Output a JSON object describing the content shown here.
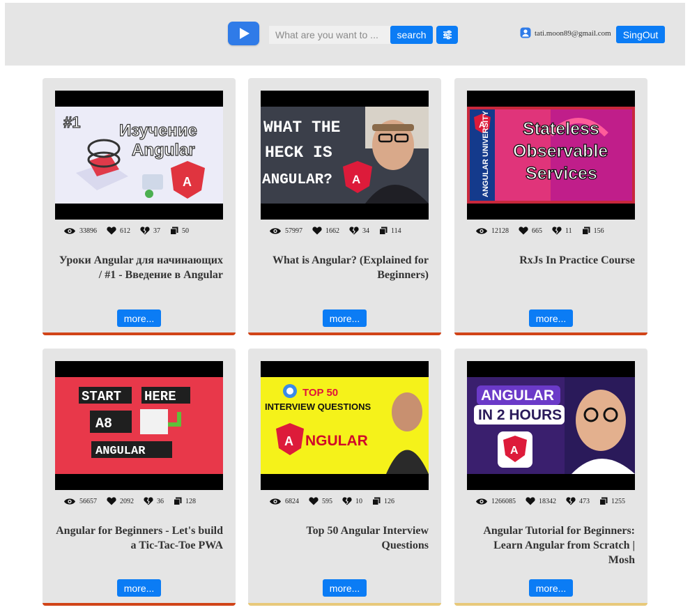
{
  "header": {
    "search_placeholder": "What are you want to ...",
    "search_label": "search",
    "user_email": "tati.moon89@gmail.com",
    "signout_label": "SingOut"
  },
  "colors": {
    "accent": "#0b7cf5",
    "card_bar_red": "#d14418",
    "card_bar_gold": "#e8c97a"
  },
  "cards": [
    {
      "views": "33896",
      "likes": "612",
      "dislikes": "37",
      "comments": "50",
      "title": "Уроки Angular для начинающих / #1 - Введение в Angular",
      "more_label": "more...",
      "thumb_text": [
        "#1",
        "Изучение",
        "Angular"
      ]
    },
    {
      "views": "57997",
      "likes": "1662",
      "dislikes": "34",
      "comments": "114",
      "title": "What is Angular? (Explained for Beginners)",
      "more_label": "more...",
      "thumb_text": [
        "WHAT THE",
        "HECK IS",
        "ANGULAR?"
      ]
    },
    {
      "views": "12128",
      "likes": "665",
      "dislikes": "11",
      "comments": "156",
      "title": "RxJs In Practice Course",
      "more_label": "more...",
      "thumb_text": [
        "Stateless",
        "Observable",
        "Services",
        "ANGULAR UNIVERSITY"
      ]
    },
    {
      "views": "56657",
      "likes": "2092",
      "dislikes": "36",
      "comments": "128",
      "title": "Angular for Beginners - Let's build a Tic-Tac-Toe PWA",
      "more_label": "more...",
      "thumb_text": [
        "START",
        "HERE",
        "ANGULAR"
      ]
    },
    {
      "views": "6824",
      "likes": "595",
      "dislikes": "10",
      "comments": "126",
      "title": "Top 50 Angular Interview Questions",
      "more_label": "more...",
      "thumb_text": [
        "TOP 50",
        "INTERVIEW QUESTIONS",
        "NGULAR"
      ]
    },
    {
      "views": "1266085",
      "likes": "18342",
      "dislikes": "473",
      "comments": "1255",
      "title": "Angular Tutorial for Beginners: Learn Angular from Scratch | Mosh",
      "more_label": "more...",
      "thumb_text": [
        "ANGULAR",
        "IN 2 HOURS"
      ]
    }
  ]
}
